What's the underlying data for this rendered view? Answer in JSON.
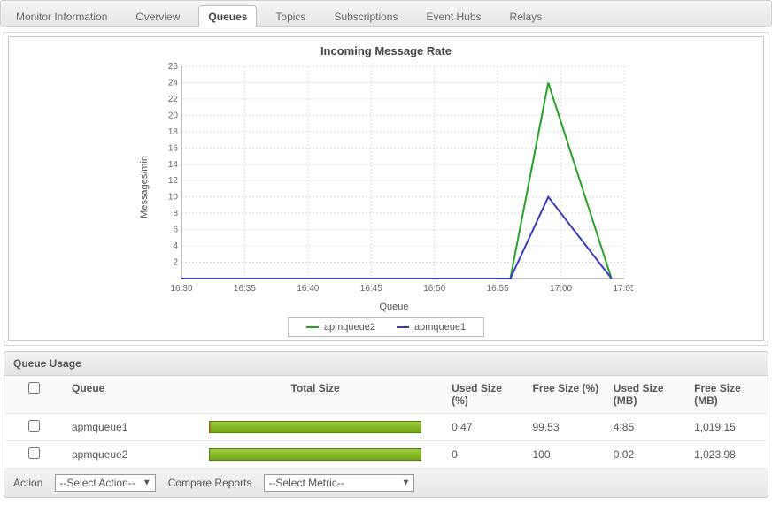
{
  "tabs": [
    {
      "label": "Monitor Information",
      "active": false
    },
    {
      "label": "Overview",
      "active": false
    },
    {
      "label": "Queues",
      "active": true
    },
    {
      "label": "Topics",
      "active": false
    },
    {
      "label": "Subscriptions",
      "active": false
    },
    {
      "label": "Event Hubs",
      "active": false
    },
    {
      "label": "Relays",
      "active": false
    }
  ],
  "chart_data": {
    "type": "line",
    "title": "Incoming Message Rate",
    "xlabel": "Queue",
    "ylabel": "Messages/min",
    "x_ticks": [
      "16:30",
      "16:35",
      "16:40",
      "16:45",
      "16:50",
      "16:55",
      "17:00",
      "17:05"
    ],
    "y_ticks": [
      2,
      4,
      6,
      8,
      10,
      12,
      14,
      16,
      18,
      20,
      22,
      24,
      26
    ],
    "ylim": [
      0,
      26
    ],
    "series": [
      {
        "name": "apmqueue2",
        "color": "#2aa02a",
        "points": [
          {
            "x": "16:30",
            "y": 0
          },
          {
            "x": "16:35",
            "y": 0
          },
          {
            "x": "16:40",
            "y": 0
          },
          {
            "x": "16:45",
            "y": 0
          },
          {
            "x": "16:50",
            "y": 0
          },
          {
            "x": "16:56",
            "y": 0
          },
          {
            "x": "16:59",
            "y": 24
          },
          {
            "x": "17:04",
            "y": 0
          }
        ]
      },
      {
        "name": "apmqueue1",
        "color": "#3b3bbf",
        "points": [
          {
            "x": "16:30",
            "y": 0
          },
          {
            "x": "16:35",
            "y": 0
          },
          {
            "x": "16:40",
            "y": 0
          },
          {
            "x": "16:45",
            "y": 0
          },
          {
            "x": "16:50",
            "y": 0
          },
          {
            "x": "16:56",
            "y": 0
          },
          {
            "x": "16:59",
            "y": 10
          },
          {
            "x": "17:04",
            "y": 0
          }
        ]
      }
    ]
  },
  "queue_section": {
    "title": "Queue Usage",
    "columns": {
      "queue": "Queue",
      "total_size": "Total Size",
      "used_pct": "Used Size (%)",
      "free_pct": "Free Size (%)",
      "used_mb": "Used Size (MB)",
      "free_mb": "Free Size (MB)"
    },
    "rows": [
      {
        "queue": "apmqueue1",
        "used_pct": "0.47",
        "free_pct": "99.53",
        "used_mb": "4.85",
        "free_mb": "1,019.15",
        "used_bar_pct": 0.47
      },
      {
        "queue": "apmqueue2",
        "used_pct": "0",
        "free_pct": "100",
        "used_mb": "0.02",
        "free_mb": "1,023.98",
        "used_bar_pct": 0
      }
    ]
  },
  "footer": {
    "action_label": "Action",
    "action_value": "--Select Action--",
    "compare_label": "Compare Reports",
    "compare_value": "--Select Metric--"
  }
}
